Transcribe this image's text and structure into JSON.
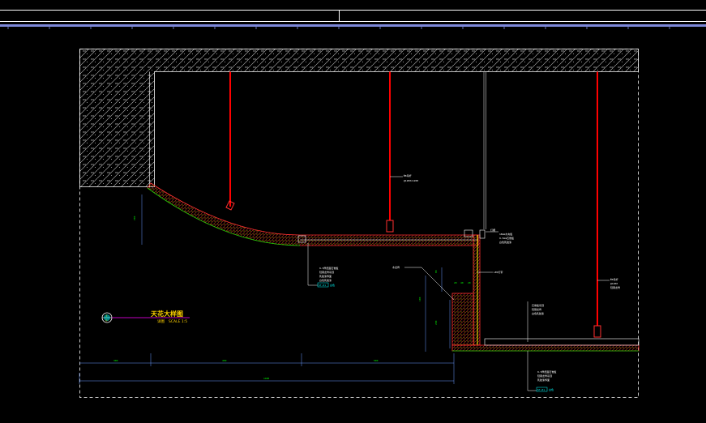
{
  "drawing": {
    "title": "天花大样图",
    "subtitle_left": "详图",
    "subtitle_right": "SCALE 1:5",
    "marker_number": "1",
    "marker_sheet": "D"
  },
  "colors": {
    "background": "#000000",
    "frame": "#ffffff",
    "hatch": "#c8c8c8",
    "hanger": "#ff0000",
    "board": "#ff3030",
    "finish": "#00cc00",
    "dim": "#00ff00",
    "dim_line": "#6a9aff",
    "accent": "#ffff00",
    "title": "#ffd200",
    "magenta": "#ff00ff",
    "cyan": "#00ffff",
    "ruler": "#7c87d8"
  },
  "dimensions": {
    "seg1": "300",
    "seg2": "450",
    "seg3": "500",
    "total": "1400",
    "left_height": "200",
    "drop_top": "80",
    "drop_mid": "100",
    "drop_low": "200",
    "drop_base": "500",
    "small1": "20",
    "small2": "40",
    "small3": "20"
  },
  "notes": {
    "hanger_mid": [
      "Φ8吊杆",
      "@1200×1200"
    ],
    "board_note": [
      "9.5厚纸面石膏板",
      "轻钢龙骨吊顶",
      "乳胶漆饰面",
      "白色乳胶漆"
    ],
    "board_tag": "ST-01",
    "board_tag_tail": "白色",
    "small_label": "木龙骨",
    "right_top": [
      "灯槽",
      "18mm木夹板",
      "9.5mm石膏板",
      "白色乳胶漆"
    ],
    "right_mid": "LED灯带",
    "hanger_right": [
      "Φ8吊杆",
      "@1200",
      "轻钢龙骨"
    ],
    "lower_right": [
      "石膏板吊顶",
      "轻钢龙骨",
      "白色乳胶漆"
    ],
    "bottom_note": [
      "9.5厚纸面石膏板",
      "轻钢龙骨吊顶",
      "乳胶漆饰面"
    ],
    "bottom_tag": "ST-01",
    "bottom_tag_tail": "白色"
  }
}
